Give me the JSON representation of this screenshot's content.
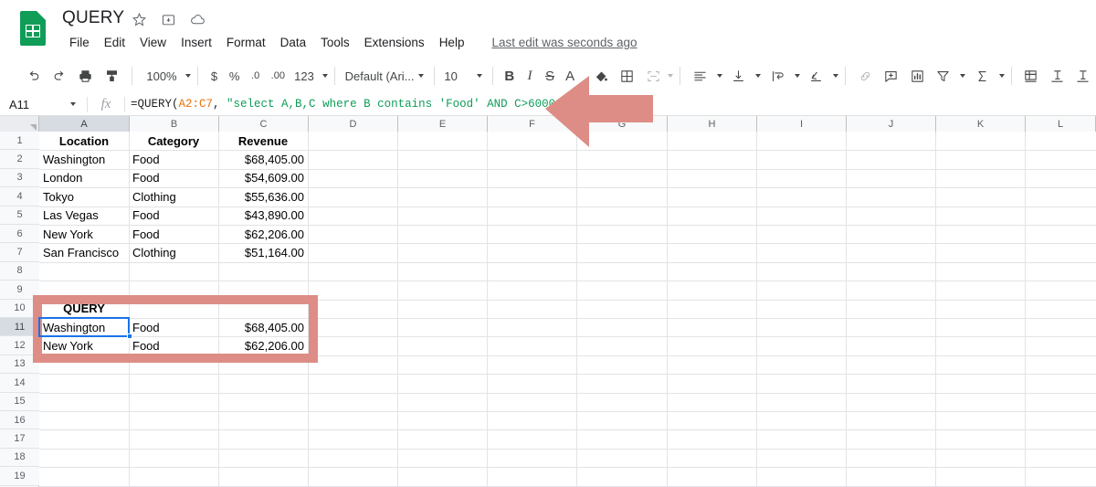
{
  "app": {
    "logo_icon": "sheets-logo-icon",
    "doc_title": "QUERY",
    "title_icons": [
      "star-icon",
      "move-to-folder-icon",
      "cloud-saved-icon"
    ],
    "menu": [
      "File",
      "Edit",
      "View",
      "Insert",
      "Format",
      "Data",
      "Tools",
      "Extensions",
      "Help"
    ],
    "last_edit": "Last edit was seconds ago"
  },
  "toolbar": {
    "undo_icon": "undo-icon",
    "redo_icon": "redo-icon",
    "print_icon": "print-icon",
    "paint_format_icon": "paint-format-icon",
    "zoom": "100%",
    "currency_icon": "$",
    "percent_icon": "%",
    "decimal_decrease_icon": ".0",
    "decimal_increase_icon": ".00",
    "number_format_label": "123",
    "font_family": "Default (Ari...",
    "font_size": "10",
    "bold_label": "B",
    "italic_label": "I",
    "strikethrough_label": "S",
    "text_color_label": "A",
    "fill_color_icon": "fill-color-icon",
    "borders_icon": "borders-icon",
    "merge_cells_icon": "merge-cells-icon",
    "halign_icon": "horizontal-align-icon",
    "valign_icon": "vertical-align-icon",
    "text_wrap_icon": "text-wrap-icon",
    "text_rotation_icon": "text-rotation-icon",
    "link_icon": "insert-link-icon",
    "comment_icon": "insert-comment-icon",
    "chart_icon": "insert-chart-icon",
    "filter_icon": "create-filter-icon",
    "functions_icon": "functions-sigma-icon",
    "freeze_icon": "freeze-icon",
    "para1_icon": "paragraph-one-icon",
    "para2_icon": "paragraph-two-icon"
  },
  "formula_bar": {
    "name_box": "A11",
    "fx_label": "fx",
    "formula_prefix": "=QUERY(",
    "formula_ref": "A2:C7",
    "formula_mid": ", ",
    "formula_string": "\"select A,B,C where B contains 'Food' AND C>60000\"",
    "formula_suffix": ")"
  },
  "grid": {
    "columns": [
      "A",
      "B",
      "C",
      "D",
      "E",
      "F",
      "G",
      "H",
      "I",
      "J",
      "K",
      "L"
    ],
    "selected_column": "A",
    "rows": [
      "1",
      "2",
      "3",
      "4",
      "5",
      "6",
      "7",
      "8",
      "9",
      "10",
      "11",
      "12",
      "13",
      "14",
      "15",
      "16",
      "17",
      "18",
      "19"
    ],
    "selected_row": "11",
    "headers": {
      "a": "Location",
      "b": "Category",
      "c": "Revenue"
    },
    "source_table": [
      {
        "location": "Washington",
        "category": "Food",
        "revenue": "$68,405.00"
      },
      {
        "location": "London",
        "category": "Food",
        "revenue": "$54,609.00"
      },
      {
        "location": "Tokyo",
        "category": "Clothing",
        "revenue": "$55,636.00"
      },
      {
        "location": "Las Vegas",
        "category": "Food",
        "revenue": "$43,890.00"
      },
      {
        "location": "New York",
        "category": "Food",
        "revenue": "$62,206.00"
      },
      {
        "location": "San Francisco",
        "category": "Clothing",
        "revenue": "$51,164.00"
      }
    ],
    "query_label": "QUERY",
    "query_results": [
      {
        "location": "Washington",
        "category": "Food",
        "revenue": "$68,405.00"
      },
      {
        "location": "New York",
        "category": "Food",
        "revenue": "$62,206.00"
      }
    ],
    "active_cell": "A11"
  },
  "annotations": {
    "color": "#dd8d86",
    "arrow_icon": "left-pointing-arrow-annotation",
    "highlight_box_icon": "rectangle-highlight-annotation"
  }
}
